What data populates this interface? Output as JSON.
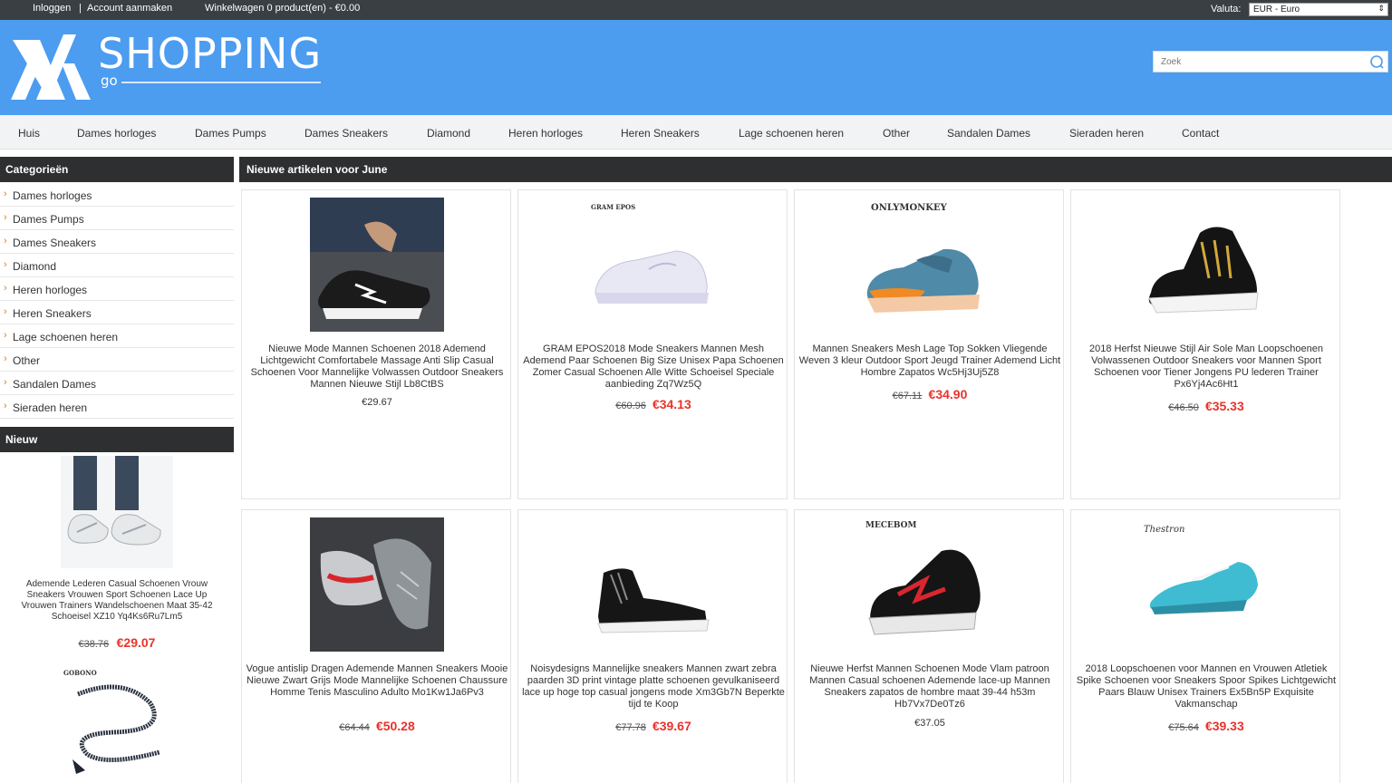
{
  "topbar": {
    "login": "Inloggen",
    "separator": "|",
    "register": "Account aanmaken",
    "cart": "Winkelwagen 0 product(en) - €0.00",
    "currency_label": "Valuta:",
    "currency_value": "EUR - Euro"
  },
  "header": {
    "logo_title": "SHOPPING",
    "logo_sub": "go",
    "search_placeholder": "Zoek",
    "brand_color": "#4c9cf0"
  },
  "nav": [
    "Huis",
    "Dames horloges",
    "Dames Pumps",
    "Dames Sneakers",
    "Diamond",
    "Heren horloges",
    "Heren Sneakers",
    "Lage schoenen heren",
    "Other",
    "Sandalen Dames",
    "Sieraden heren",
    "Contact"
  ],
  "sidebar": {
    "categories_title": "Categorieën",
    "categories": [
      "Dames horloges",
      "Dames Pumps",
      "Dames Sneakers",
      "Diamond",
      "Heren horloges",
      "Heren Sneakers",
      "Lage schoenen heren",
      "Other",
      "Sandalen Dames",
      "Sieraden heren"
    ],
    "new_title": "Nieuw",
    "new_items": [
      {
        "name": "Ademende Lederen Casual Schoenen Vrouw Sneakers Vrouwen Sport Schoenen Lace Up Vrouwen Trainers Wandelschoenen Maat 35-42 Schoeisel XZ10 Yq4Ks6Ru7Lm5",
        "old_price": "€38.76",
        "price": "€29.07"
      },
      {
        "brand": "GOBONO"
      }
    ]
  },
  "main": {
    "title": "Nieuwe artikelen voor June",
    "products": [
      {
        "name": "Nieuwe Mode Mannen Schoenen 2018 Ademend Lichtgewicht Comfortabele Massage Anti Slip Casual Schoenen Voor Mannelijke Volwassen Outdoor Sneakers Mannen Nieuwe Stijl Lb8CtBS",
        "old_price": "",
        "price": "€29.67",
        "brand": ""
      },
      {
        "name": "GRAM EPOS2018 Mode Sneakers Mannen Mesh Ademend Paar Schoenen Big Size Unisex Papa Schoenen Zomer Casual Schoenen Alle Witte Schoeisel Speciale aanbieding Zq7Wz5Q",
        "old_price": "€60.96",
        "price": "€34.13",
        "brand": "GRAM EPOS"
      },
      {
        "name": "Mannen Sneakers Mesh Lage Top Sokken Vliegende Weven 3 kleur Outdoor Sport Jeugd Trainer Ademend Licht Hombre Zapatos Wc5Hj3Uj5Z8",
        "old_price": "€67.11",
        "price": "€34.90",
        "brand": "ONLYMONKEY"
      },
      {
        "name": "2018 Herfst Nieuwe Stijl Air Sole Man Loopschoenen Volwassenen Outdoor Sneakers voor Mannen Sport Schoenen voor Tiener Jongens PU lederen Trainer Px6Yj4Ac6Ht1",
        "old_price": "€46.50",
        "price": "€35.33",
        "brand": ""
      },
      {
        "name": "Vogue antislip Dragen Ademende Mannen Sneakers Mooie Nieuwe Zwart Grijs Mode Mannelijke Schoenen Chaussure Homme Tenis Masculino Adulto Mo1Kw1Ja6Pv3",
        "old_price": "€64.44",
        "price": "€50.28",
        "brand": ""
      },
      {
        "name": "Noisydesigns Mannelijke sneakers Mannen zwart zebra paarden 3D print vintage platte schoenen gevulkaniseerd lace up hoge top casual jongens mode Xm3Gb7N Beperkte tijd te Koop",
        "old_price": "€77.78",
        "price": "€39.67",
        "brand": ""
      },
      {
        "name": "Nieuwe Herfst Mannen Schoenen Mode Vlam patroon Mannen Casual schoenen Ademende lace-up Mannen Sneakers zapatos de hombre maat 39-44 h53m Hb7Vx7De0Tz6",
        "old_price": "",
        "price": "€37.05",
        "brand": "MECEBOM"
      },
      {
        "name": "2018 Loopschoenen voor Mannen en Vrouwen Atletiek Spike Schoenen voor Sneakers Spoor Spikes Lichtgewicht Paars Blauw Unisex Trainers Ex5Bn5P Exquisite Vakmanschap",
        "old_price": "€75.64",
        "price": "€39.33",
        "brand": "Thestron"
      }
    ]
  }
}
